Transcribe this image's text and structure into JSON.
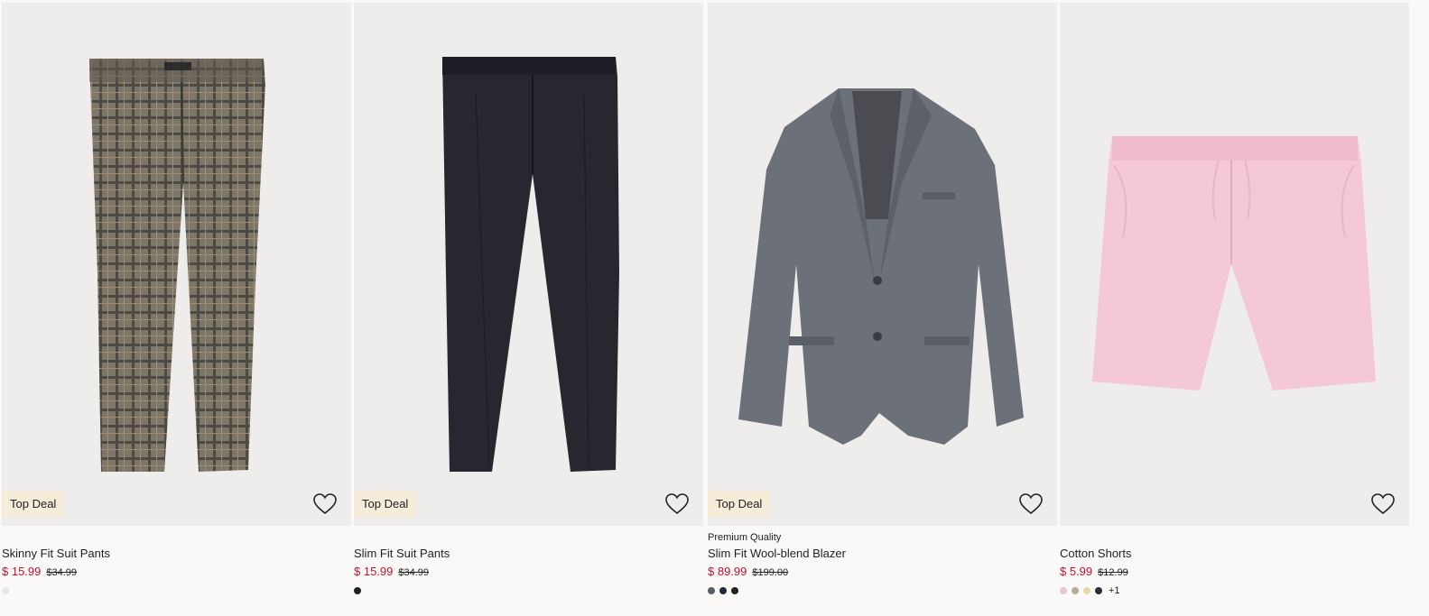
{
  "products": [
    {
      "badge": "Top Deal",
      "premium": "",
      "title": "Skinny Fit Suit Pants",
      "price": "$ 15.99",
      "original_price": "$34.99",
      "favorite_icon": "heart-outline-icon",
      "swatches": [
        "#e9e7e4"
      ],
      "more_colors": ""
    },
    {
      "badge": "Top Deal",
      "premium": "",
      "title": "Slim Fit Suit Pants",
      "price": "$ 15.99",
      "original_price": "$34.99",
      "favorite_icon": "heart-outline-icon",
      "swatches": [
        "#222222"
      ],
      "more_colors": ""
    },
    {
      "badge": "Top Deal",
      "premium": "Premium Quality",
      "title": "Slim Fit Wool-blend Blazer",
      "price": "$ 89.99",
      "original_price": "$199.00",
      "favorite_icon": "heart-outline-icon",
      "swatches": [
        "#5a5d63",
        "#1f2a3a",
        "#222222"
      ],
      "more_colors": ""
    },
    {
      "badge": "",
      "premium": "",
      "title": "Cotton Shorts",
      "price": "$ 5.99",
      "original_price": "$12.99",
      "favorite_icon": "heart-outline-icon",
      "swatches": [
        "#e8c5d6",
        "#b7ad96",
        "#e4dba0",
        "#2a2d35"
      ],
      "more_colors": "+1"
    }
  ],
  "colors": {
    "sale_price": "#c8102e",
    "badge_bg": "#f5ecd9",
    "image_bg": "#eeedeb",
    "page_bg": "#faf9f8"
  }
}
